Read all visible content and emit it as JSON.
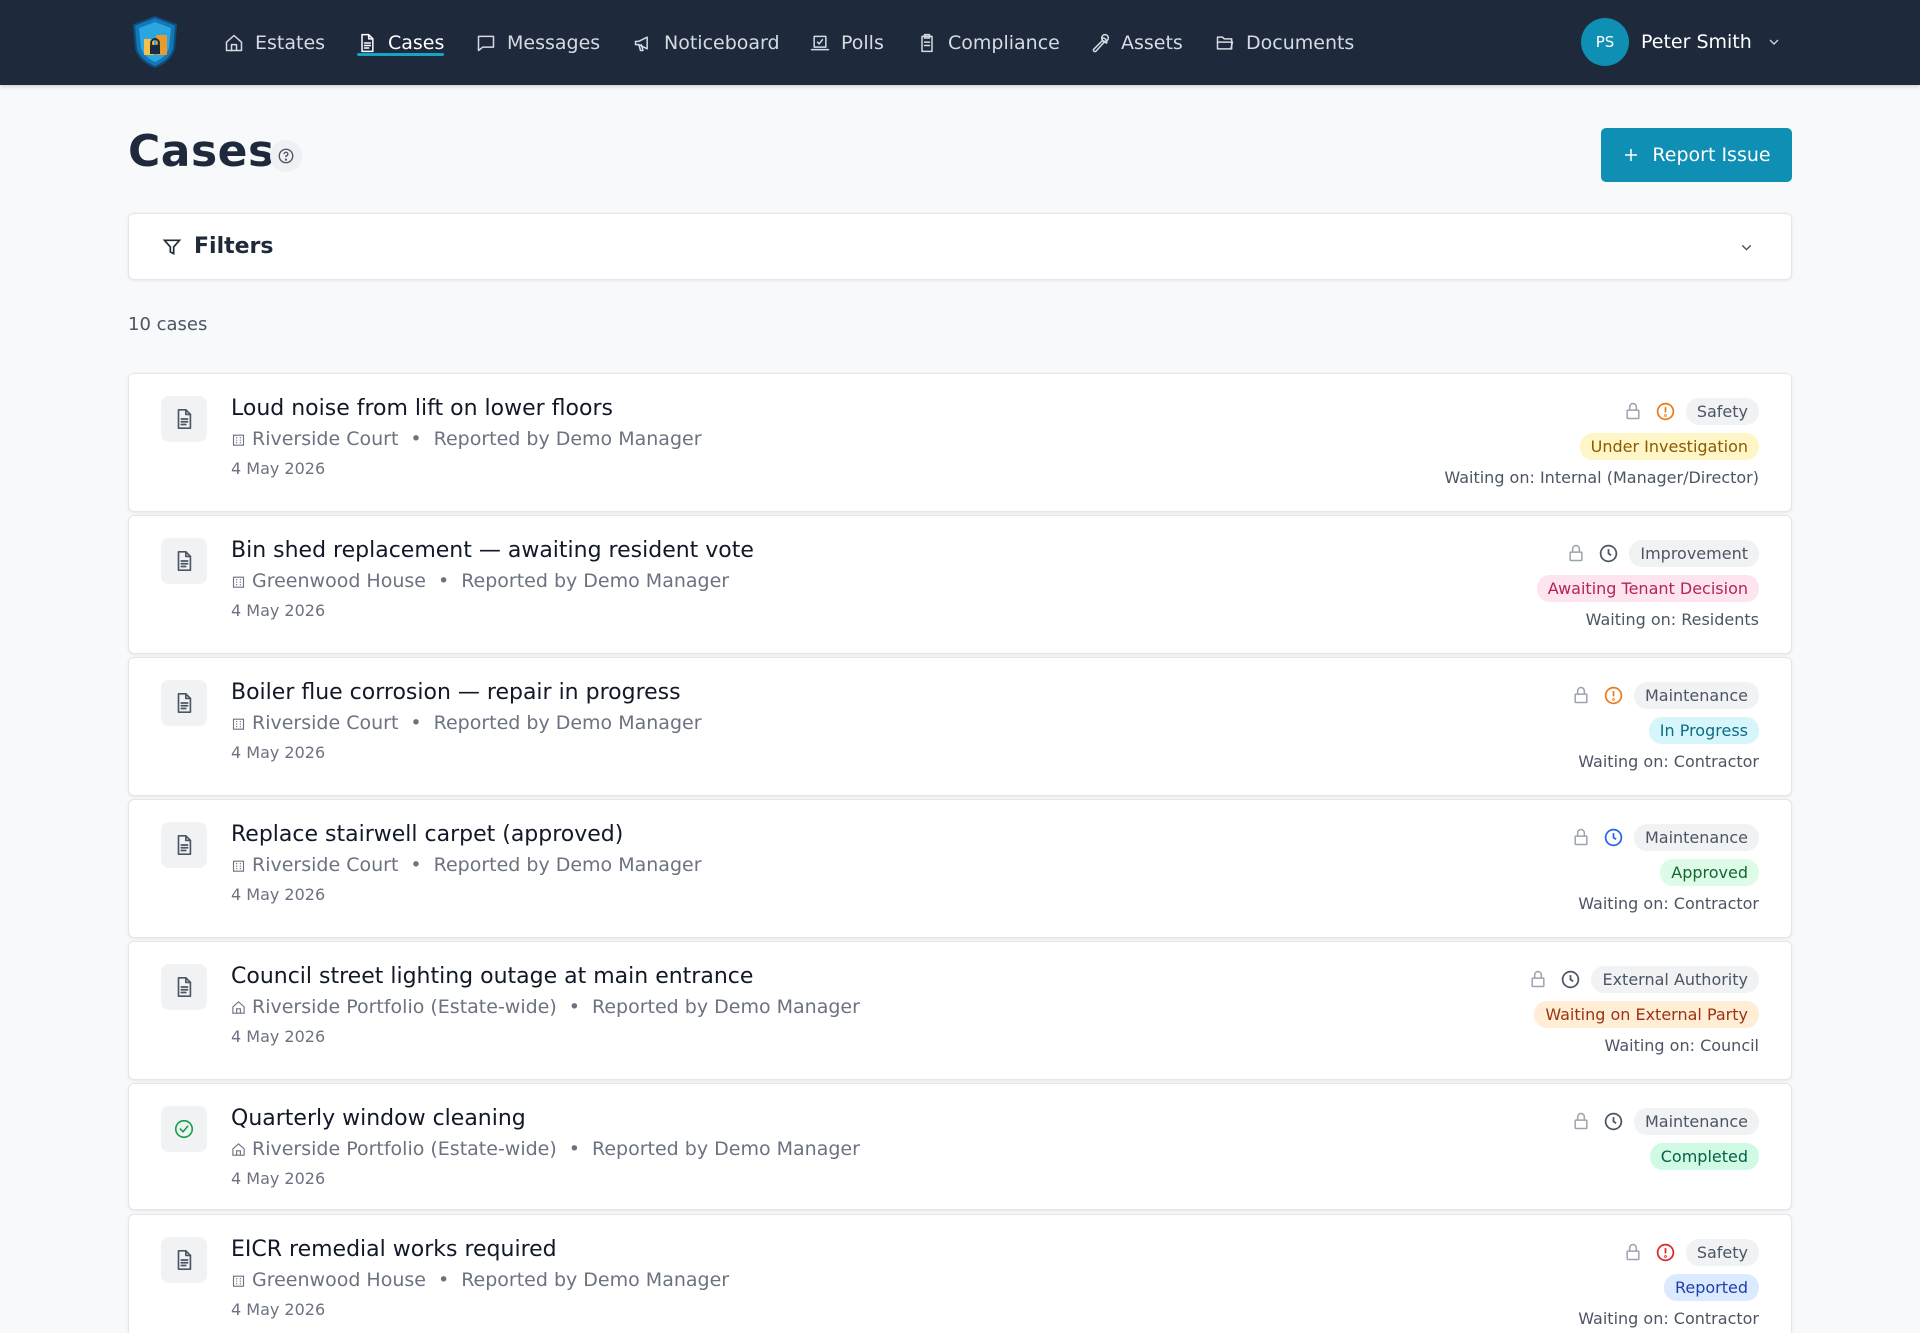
{
  "nav": {
    "items": [
      {
        "label": "Estates",
        "icon": "home-icon"
      },
      {
        "label": "Cases",
        "icon": "document-icon"
      },
      {
        "label": "Messages",
        "icon": "message-square-icon"
      },
      {
        "label": "Noticeboard",
        "icon": "megaphone-icon"
      },
      {
        "label": "Polls",
        "icon": "vote-icon"
      },
      {
        "label": "Compliance",
        "icon": "clipboard-icon"
      },
      {
        "label": "Assets",
        "icon": "wrench-icon"
      },
      {
        "label": "Documents",
        "icon": "folder-open-icon"
      }
    ],
    "active": "Cases",
    "user": {
      "initials": "PS",
      "name": "Peter Smith"
    }
  },
  "page": {
    "title": "Cases",
    "report_button": "Report Issue",
    "filters_label": "Filters",
    "count_text": "10 cases"
  },
  "colors": {
    "nav_bg": "#1e293b",
    "accent": "#0e8fb3",
    "priority_high": "#ea7a1a",
    "priority_urgent": "#dc2626",
    "priority_low": "#4b5563",
    "priority_scheduled": "#2563eb"
  },
  "cases": [
    {
      "title": "Loud noise from lift on lower floors",
      "location": "Riverside Court",
      "location_icon": "building-icon",
      "reporter": "Reported by Demo Manager",
      "date": "4 May 2026",
      "type_icon": "document-icon",
      "priority_icon": "alert-circle-icon",
      "priority_color": "#ea7a1a",
      "category": "Safety",
      "status": "Under Investigation",
      "status_bg": "#fef6c7",
      "status_fg": "#8a5a00",
      "waiting": "Waiting on: Internal (Manager/Director)"
    },
    {
      "title": "Bin shed replacement — awaiting resident vote",
      "location": "Greenwood House",
      "location_icon": "building-icon",
      "reporter": "Reported by Demo Manager",
      "date": "4 May 2026",
      "type_icon": "document-icon",
      "priority_icon": "clock-icon",
      "priority_color": "#4b5563",
      "category": "Improvement",
      "status": "Awaiting Tenant Decision",
      "status_bg": "#fde4ee",
      "status_fg": "#b4235a",
      "waiting": "Waiting on: Residents"
    },
    {
      "title": "Boiler flue corrosion — repair in progress",
      "location": "Riverside Court",
      "location_icon": "building-icon",
      "reporter": "Reported by Demo Manager",
      "date": "4 May 2026",
      "type_icon": "document-icon",
      "priority_icon": "alert-circle-icon",
      "priority_color": "#ea7a1a",
      "category": "Maintenance",
      "status": "In Progress",
      "status_bg": "#d7f6fb",
      "status_fg": "#0b6d86",
      "waiting": "Waiting on: Contractor"
    },
    {
      "title": "Replace stairwell carpet (approved)",
      "location": "Riverside Court",
      "location_icon": "building-icon",
      "reporter": "Reported by Demo Manager",
      "date": "4 May 2026",
      "type_icon": "document-icon",
      "priority_icon": "clock-icon",
      "priority_color": "#2563eb",
      "category": "Maintenance",
      "status": "Approved",
      "status_bg": "#dcfce7",
      "status_fg": "#166534",
      "waiting": "Waiting on: Contractor"
    },
    {
      "title": "Council street lighting outage at main entrance",
      "location": "Riverside Portfolio (Estate-wide)",
      "location_icon": "home-icon",
      "reporter": "Reported by Demo Manager",
      "date": "4 May 2026",
      "type_icon": "document-icon",
      "priority_icon": "clock-icon",
      "priority_color": "#4b5563",
      "category": "External Authority",
      "status": "Waiting on External Party",
      "status_bg": "#ffedd5",
      "status_fg": "#9a3412",
      "waiting": "Waiting on: Council"
    },
    {
      "title": "Quarterly window cleaning",
      "location": "Riverside Portfolio (Estate-wide)",
      "location_icon": "home-icon",
      "reporter": "Reported by Demo Manager",
      "date": "4 May 2026",
      "type_icon": "check-circle-icon",
      "priority_icon": "clock-icon",
      "priority_color": "#4b5563",
      "category": "Maintenance",
      "status": "Completed",
      "status_bg": "#d1fae5",
      "status_fg": "#065f46",
      "waiting": ""
    },
    {
      "title": "EICR remedial works required",
      "location": "Greenwood House",
      "location_icon": "building-icon",
      "reporter": "Reported by Demo Manager",
      "date": "4 May 2026",
      "type_icon": "document-icon",
      "priority_icon": "alert-circle-icon",
      "priority_color": "#dc2626",
      "category": "Safety",
      "status": "Reported",
      "status_bg": "#dbeafe",
      "status_fg": "#1e40af",
      "waiting": "Waiting on: Contractor"
    }
  ]
}
